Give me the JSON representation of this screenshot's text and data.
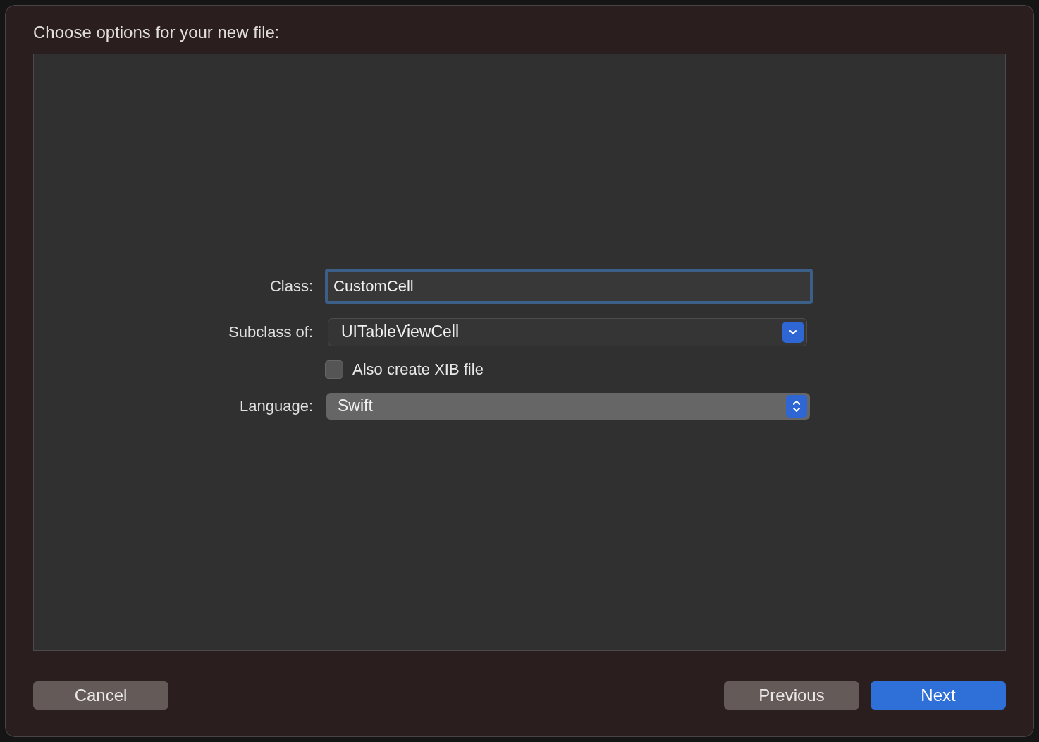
{
  "sheet": {
    "title": "Choose options for your new file:"
  },
  "form": [
    {
      "kind": "text",
      "label": "Class:",
      "value": "CustomCell",
      "focused": true
    },
    {
      "kind": "pulldown",
      "label": "Subclass of:",
      "value": "UITableViewCell"
    },
    {
      "kind": "checkbox",
      "label": "Also create XIB file",
      "checked": false
    },
    {
      "kind": "popup",
      "label": "Language:",
      "value": "Swift"
    }
  ],
  "cancel_button": {
    "label": "Cancel"
  },
  "nav_buttons": [
    {
      "label": "Previous",
      "default": false
    },
    {
      "label": "Next",
      "default": true
    }
  ]
}
